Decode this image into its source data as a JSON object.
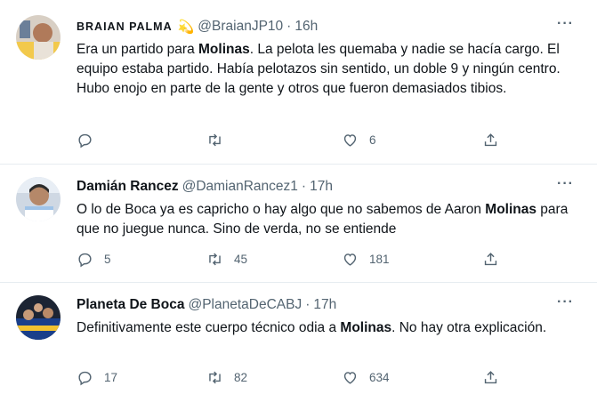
{
  "tweets": [
    {
      "name": "BRAIAN PALMA",
      "badge": "💫",
      "handle": "@BraianJP10",
      "separator": "·",
      "time": "16h",
      "text_parts": [
        "Era un partido para ",
        "Molinas",
        ". La pelota les quemaba y nadie se hacía cargo. El equipo estaba partido. Había pelotazos sin sentido, un doble 9 y ningún centro. Hubo enojo en parte de la gente y otros que fueron demasiados tibios."
      ],
      "replies": "",
      "retweets": "",
      "likes": "6"
    },
    {
      "name": "Damián Rancez",
      "handle": "@DamianRancez1",
      "separator": "·",
      "time": "17h",
      "text_parts": [
        "O lo de Boca ya es capricho o hay algo que no sabemos de Aaron ",
        "Molinas",
        " para que no juegue nunca. Sino de verda, no se entiende"
      ],
      "replies": "5",
      "retweets": "45",
      "likes": "181"
    },
    {
      "name": "Planeta De Boca",
      "handle": "@PlanetaDeCABJ",
      "separator": "·",
      "time": "17h",
      "text_parts": [
        "Definitivamente este cuerpo técnico odia a ",
        "Molinas",
        ". No hay otra explicación."
      ],
      "replies": "17",
      "retweets": "82",
      "likes": "634"
    }
  ],
  "more_label": "···",
  "icons": {
    "reply": "reply-icon",
    "retweet": "retweet-icon",
    "like": "like-icon",
    "share": "share-icon"
  },
  "colors": {
    "text": "#0f1419",
    "secondary": "#536471",
    "divider": "#e6ecf0"
  }
}
